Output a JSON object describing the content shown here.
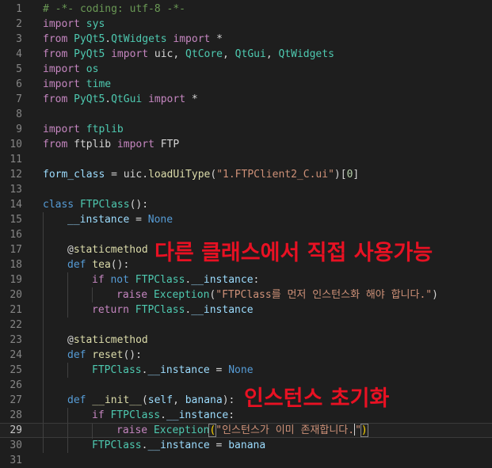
{
  "colors": {
    "background": "#1e1e1e",
    "line_number": "#858585",
    "default_text": "#d4d4d4",
    "keyword_control": "#c586c0",
    "keyword": "#569cd6",
    "string": "#ce9178",
    "function": "#dcdcaa",
    "class": "#4ec9b0",
    "variable": "#9cdcfe",
    "number": "#b5cea8",
    "comment": "#6a9955",
    "annotation": "#e81123"
  },
  "editor": {
    "current_line": 29,
    "lines": [
      {
        "n": "1",
        "indent": 0,
        "tokens": [
          [
            "# -*- coding: utf-8 -*-",
            "comment"
          ]
        ]
      },
      {
        "n": "2",
        "indent": 0,
        "tokens": [
          [
            "import",
            "keyword_control"
          ],
          [
            " sys",
            "module"
          ]
        ]
      },
      {
        "n": "3",
        "indent": 0,
        "tokens": [
          [
            "from",
            "keyword_control"
          ],
          [
            " PyQt5",
            "class"
          ],
          [
            ".",
            "plain"
          ],
          [
            "QtWidgets",
            "class"
          ],
          [
            " import",
            "keyword_control"
          ],
          [
            " *",
            "plain"
          ]
        ]
      },
      {
        "n": "4",
        "indent": 0,
        "tokens": [
          [
            "from",
            "keyword_control"
          ],
          [
            " PyQt5",
            "class"
          ],
          [
            " import",
            "keyword_control"
          ],
          [
            " uic",
            "plain"
          ],
          [
            ", ",
            "plain"
          ],
          [
            "QtCore",
            "class"
          ],
          [
            ", ",
            "plain"
          ],
          [
            "QtGui",
            "class"
          ],
          [
            ", ",
            "plain"
          ],
          [
            "QtWidgets",
            "class"
          ]
        ]
      },
      {
        "n": "5",
        "indent": 0,
        "tokens": [
          [
            "import",
            "keyword_control"
          ],
          [
            " os",
            "module"
          ]
        ]
      },
      {
        "n": "6",
        "indent": 0,
        "tokens": [
          [
            "import",
            "keyword_control"
          ],
          [
            " time",
            "module"
          ]
        ]
      },
      {
        "n": "7",
        "indent": 0,
        "tokens": [
          [
            "from",
            "keyword_control"
          ],
          [
            " PyQt5",
            "class"
          ],
          [
            ".",
            "plain"
          ],
          [
            "QtGui",
            "class"
          ],
          [
            " import",
            "keyword_control"
          ],
          [
            " *",
            "plain"
          ]
        ]
      },
      {
        "n": "8",
        "indent": 0,
        "tokens": []
      },
      {
        "n": "9",
        "indent": 0,
        "tokens": [
          [
            "import",
            "keyword_control"
          ],
          [
            " ftplib",
            "module"
          ]
        ]
      },
      {
        "n": "10",
        "indent": 0,
        "tokens": [
          [
            "from",
            "keyword_control"
          ],
          [
            " ftplib",
            "plain"
          ],
          [
            " import",
            "keyword_control"
          ],
          [
            " FTP",
            "plain"
          ]
        ]
      },
      {
        "n": "11",
        "indent": 0,
        "tokens": []
      },
      {
        "n": "12",
        "indent": 0,
        "tokens": [
          [
            "form_class",
            "variable"
          ],
          [
            " = ",
            "plain"
          ],
          [
            "uic",
            "plain"
          ],
          [
            ".",
            "plain"
          ],
          [
            "loadUiType",
            "function"
          ],
          [
            "(",
            "plain"
          ],
          [
            "\"1.FTPClient2_C.ui\"",
            "string"
          ],
          [
            ")[",
            "plain"
          ],
          [
            "0",
            "number"
          ],
          [
            "]",
            "plain"
          ]
        ]
      },
      {
        "n": "13",
        "indent": 0,
        "tokens": []
      },
      {
        "n": "14",
        "indent": 0,
        "tokens": [
          [
            "class",
            "keyword"
          ],
          [
            " FTPClass",
            "class"
          ],
          [
            "():",
            "plain"
          ]
        ]
      },
      {
        "n": "15",
        "indent": 1,
        "tokens": [
          [
            "__instance",
            "variable"
          ],
          [
            " = ",
            "plain"
          ],
          [
            "None",
            "keyword"
          ]
        ]
      },
      {
        "n": "16",
        "indent": 1,
        "tokens": []
      },
      {
        "n": "17",
        "indent": 1,
        "tokens": [
          [
            "@",
            "plain"
          ],
          [
            "staticmethod",
            "function"
          ]
        ]
      },
      {
        "n": "18",
        "indent": 1,
        "tokens": [
          [
            "def",
            "keyword"
          ],
          [
            " tea",
            "function"
          ],
          [
            "():",
            "plain"
          ]
        ]
      },
      {
        "n": "19",
        "indent": 2,
        "tokens": [
          [
            "if",
            "keyword_control"
          ],
          [
            " not",
            "keyword"
          ],
          [
            " FTPClass",
            "class"
          ],
          [
            ".",
            "plain"
          ],
          [
            "__instance",
            "variable"
          ],
          [
            ":",
            "plain"
          ]
        ]
      },
      {
        "n": "20",
        "indent": 3,
        "tokens": [
          [
            "raise",
            "keyword_control"
          ],
          [
            " Exception",
            "class"
          ],
          [
            "(",
            "plain"
          ],
          [
            "\"FTPClass를 먼저 인스턴스화 해야 합니다.\"",
            "string"
          ],
          [
            ")",
            "plain"
          ]
        ]
      },
      {
        "n": "21",
        "indent": 2,
        "tokens": [
          [
            "return",
            "keyword_control"
          ],
          [
            " FTPClass",
            "class"
          ],
          [
            ".",
            "plain"
          ],
          [
            "__instance",
            "variable"
          ]
        ]
      },
      {
        "n": "22",
        "indent": 1,
        "tokens": []
      },
      {
        "n": "23",
        "indent": 1,
        "tokens": [
          [
            "@",
            "plain"
          ],
          [
            "staticmethod",
            "function"
          ]
        ]
      },
      {
        "n": "24",
        "indent": 1,
        "tokens": [
          [
            "def",
            "keyword"
          ],
          [
            " reset",
            "function"
          ],
          [
            "():",
            "plain"
          ]
        ]
      },
      {
        "n": "25",
        "indent": 2,
        "tokens": [
          [
            "FTPClass",
            "class"
          ],
          [
            ".",
            "plain"
          ],
          [
            "__instance",
            "variable"
          ],
          [
            " = ",
            "plain"
          ],
          [
            "None",
            "keyword"
          ]
        ]
      },
      {
        "n": "26",
        "indent": 1,
        "tokens": []
      },
      {
        "n": "27",
        "indent": 1,
        "tokens": [
          [
            "def",
            "keyword"
          ],
          [
            " __init__",
            "function"
          ],
          [
            "(",
            "plain"
          ],
          [
            "self",
            "variable"
          ],
          [
            ", ",
            "plain"
          ],
          [
            "banana",
            "variable"
          ],
          [
            "):",
            "plain"
          ]
        ]
      },
      {
        "n": "28",
        "indent": 2,
        "tokens": [
          [
            "if",
            "keyword_control"
          ],
          [
            " FTPClass",
            "class"
          ],
          [
            ".",
            "plain"
          ],
          [
            "__instance",
            "variable"
          ],
          [
            ":",
            "plain"
          ]
        ]
      },
      {
        "n": "29",
        "indent": 3,
        "tokens": [
          [
            "raise",
            "keyword_control"
          ],
          [
            " Exception",
            "class"
          ],
          [
            "(",
            "bracket"
          ],
          [
            "\"인스턴스가 이미 존재합니다.",
            "string"
          ],
          [
            "CURSOR",
            "cursor"
          ],
          [
            "\"",
            "string"
          ],
          [
            ")",
            "bracket"
          ]
        ]
      },
      {
        "n": "30",
        "indent": 2,
        "tokens": [
          [
            "FTPClass",
            "class"
          ],
          [
            ".",
            "plain"
          ],
          [
            "__instance",
            "variable"
          ],
          [
            " = ",
            "plain"
          ],
          [
            "banana",
            "variable"
          ]
        ]
      },
      {
        "n": "31",
        "indent": 0,
        "tokens": []
      }
    ]
  },
  "annotations": {
    "static_method_note": "다른 클래스에서 직접 사용가능",
    "instance_init_note": "인스턴스 초기화"
  }
}
